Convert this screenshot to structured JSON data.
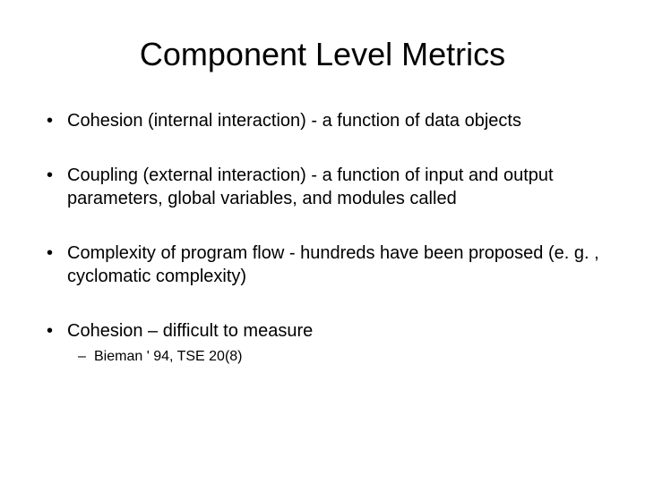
{
  "slide": {
    "title": "Component Level Metrics",
    "bullets": [
      {
        "text": "Cohesion (internal interaction) - a function of data objects"
      },
      {
        "text": "Coupling (external interaction) - a function of input and output parameters, global variables, and modules called"
      },
      {
        "text": "Complexity of program flow - hundreds have been proposed (e. g. , cyclomatic complexity)"
      },
      {
        "text": "Cohesion – difficult to measure",
        "subbullets": [
          {
            "text": "Bieman ' 94, TSE 20(8)"
          }
        ]
      }
    ]
  }
}
